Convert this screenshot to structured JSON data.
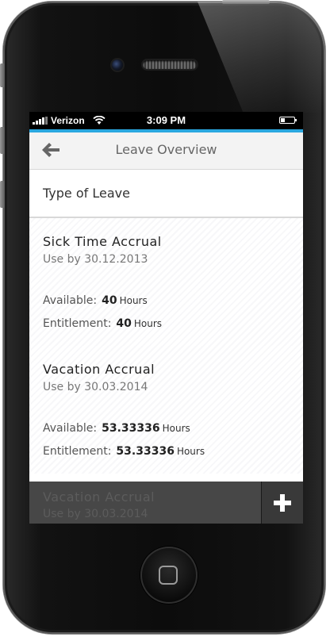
{
  "status_bar": {
    "carrier": "Verizon",
    "time": "3:09 PM",
    "icons": [
      "signal-icon",
      "wifi-icon",
      "battery-icon"
    ]
  },
  "header": {
    "title": "Leave Overview",
    "back_icon": "back-arrow-icon"
  },
  "section": {
    "title": "Type of Leave"
  },
  "leaves": [
    {
      "name": "Sick Time Accrual",
      "use_by": "Use by 30.12.2013",
      "available_label": "Available:",
      "available_value": "40",
      "entitlement_label": "Entitlement:",
      "entitlement_value": "40",
      "unit": "Hours"
    },
    {
      "name": "Vacation Accrual",
      "use_by": "Use by 30.03.2014",
      "available_label": "Available:",
      "available_value": "53.33336",
      "entitlement_label": "Entitlement:",
      "entitlement_value": "53.33336",
      "unit": "Hours"
    },
    {
      "name": "Vacation Accrual",
      "use_by": "Use by 30.03.2014"
    }
  ],
  "bottom_bar": {
    "add_icon": "plus-icon"
  },
  "colors": {
    "accent": "#2aa7df",
    "status_bar": "#000000",
    "header_bg": "#f3f3f3"
  }
}
